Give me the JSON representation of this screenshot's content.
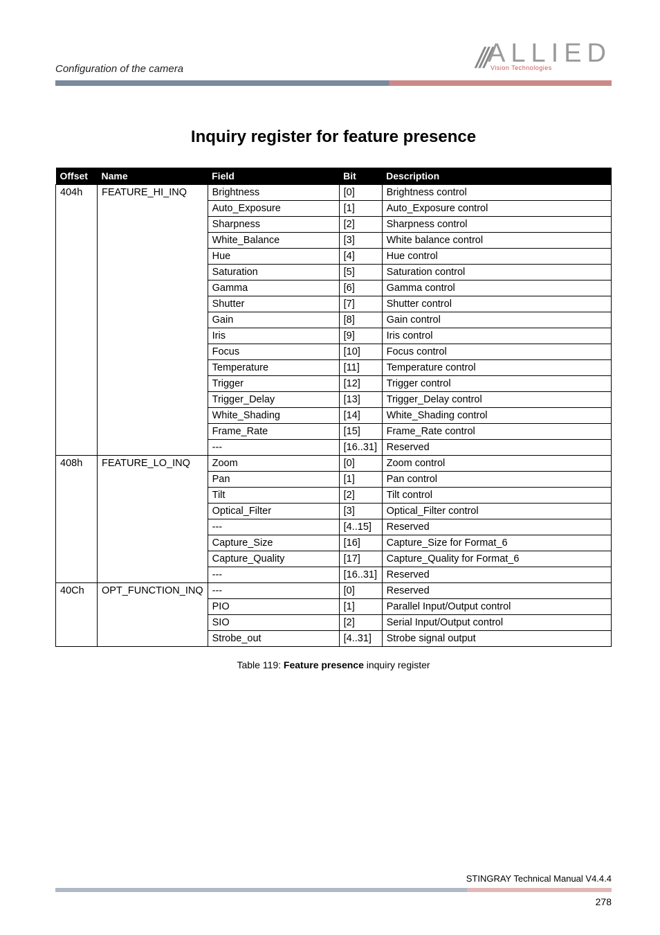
{
  "header": {
    "breadcrumb": "Configuration of the camera",
    "logo_main": "ALLIED",
    "logo_sub": "Vision Technologies"
  },
  "section_title": "Inquiry register for feature presence",
  "table": {
    "headers": {
      "c0": "Offset",
      "c1": "Name",
      "c2": "Field",
      "c3": "Bit",
      "c4": "Description"
    },
    "groups": [
      {
        "offset": "404h",
        "name": "FEATURE_HI_INQ",
        "rows": [
          {
            "field": "Brightness",
            "bit": "[0]",
            "desc": "Brightness control"
          },
          {
            "field": "Auto_Exposure",
            "bit": "[1]",
            "desc": "Auto_Exposure control"
          },
          {
            "field": "Sharpness",
            "bit": "[2]",
            "desc": "Sharpness control"
          },
          {
            "field": "White_Balance",
            "bit": "[3]",
            "desc": "White balance control"
          },
          {
            "field": "Hue",
            "bit": "[4]",
            "desc": "Hue control"
          },
          {
            "field": "Saturation",
            "bit": "[5]",
            "desc": "Saturation control"
          },
          {
            "field": "Gamma",
            "bit": "[6]",
            "desc": "Gamma control"
          },
          {
            "field": "Shutter",
            "bit": "[7]",
            "desc": "Shutter control"
          },
          {
            "field": "Gain",
            "bit": "[8]",
            "desc": "Gain control"
          },
          {
            "field": "Iris",
            "bit": "[9]",
            "desc": "Iris control"
          },
          {
            "field": "Focus",
            "bit": "[10]",
            "desc": "Focus control"
          },
          {
            "field": "Temperature",
            "bit": "[11]",
            "desc": "Temperature control"
          },
          {
            "field": "Trigger",
            "bit": "[12]",
            "desc": "Trigger control"
          },
          {
            "field": "Trigger_Delay",
            "bit": "[13]",
            "desc": "Trigger_Delay control"
          },
          {
            "field": "White_Shading",
            "bit": "[14]",
            "desc": "White_Shading control"
          },
          {
            "field": "Frame_Rate",
            "bit": "[15]",
            "desc": "Frame_Rate control"
          },
          {
            "field": "---",
            "bit": "[16..31]",
            "desc": "Reserved"
          }
        ]
      },
      {
        "offset": "408h",
        "name": "FEATURE_LO_INQ",
        "rows": [
          {
            "field": "Zoom",
            "bit": "[0]",
            "desc": "Zoom control"
          },
          {
            "field": "Pan",
            "bit": "[1]",
            "desc": "Pan control"
          },
          {
            "field": "Tilt",
            "bit": "[2]",
            "desc": "Tilt control"
          },
          {
            "field": "Optical_Filter",
            "bit": "[3]",
            "desc": "Optical_Filter control"
          },
          {
            "field": "---",
            "bit": "[4..15]",
            "desc": "Reserved"
          },
          {
            "field": "Capture_Size",
            "bit": "[16]",
            "desc": "Capture_Size for Format_6"
          },
          {
            "field": "Capture_Quality",
            "bit": "[17]",
            "desc": "Capture_Quality for Format_6"
          },
          {
            "field": "---",
            "bit": "[16..31]",
            "desc": "Reserved"
          }
        ]
      },
      {
        "offset": "40Ch",
        "name": "OPT_FUNCTION_INQ",
        "rows": [
          {
            "field": "---",
            "bit": "[0]",
            "desc": "Reserved"
          },
          {
            "field": "PIO",
            "bit": "[1]",
            "desc": "Parallel Input/Output control"
          },
          {
            "field": "SIO",
            "bit": "[2]",
            "desc": "Serial Input/Output control"
          },
          {
            "field": "Strobe_out",
            "bit": "[4..31]",
            "desc": "Strobe signal output"
          }
        ]
      }
    ]
  },
  "caption_prefix": "Table 119: ",
  "caption_bold": "Feature presence",
  "caption_suffix": " inquiry register",
  "footer": {
    "manual": "STINGRAY Technical Manual V4.4.4",
    "page": "278"
  }
}
